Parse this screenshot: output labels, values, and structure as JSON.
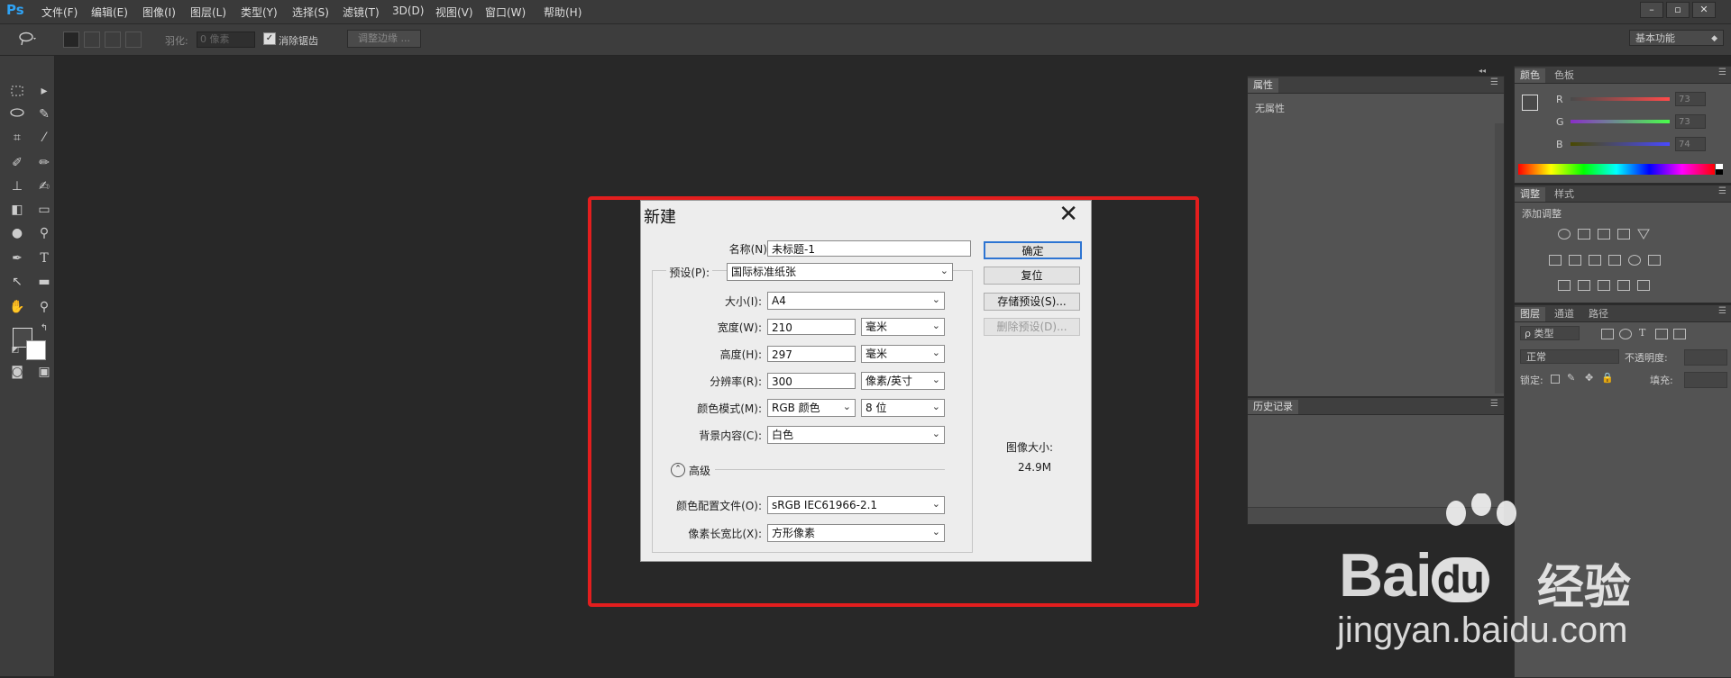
{
  "app": {
    "logo": "Ps",
    "menu": [
      "文件(F)",
      "编辑(E)",
      "图像(I)",
      "图层(L)",
      "类型(Y)",
      "选择(S)",
      "滤镜(T)",
      "3D(D)",
      "视图(V)",
      "窗口(W)",
      "帮助(H)"
    ],
    "window_buttons": [
      "–",
      "▫",
      "✕"
    ]
  },
  "options_bar": {
    "feather_label": "羽化:",
    "feather_value": "0 像素",
    "antialias_label": "消除锯齿",
    "refine_edge_button": "调整边缘 ...",
    "workspace": "基本功能"
  },
  "dialog": {
    "title": "新建",
    "close": "✕",
    "name_label": "名称(N):",
    "name_value": "未标题-1",
    "preset_label": "预设(P):",
    "preset_value": "国际标准纸张",
    "size_label": "大小(I):",
    "size_value": "A4",
    "width_label": "宽度(W):",
    "width_value": "210",
    "width_unit": "毫米",
    "height_label": "高度(H):",
    "height_value": "297",
    "height_unit": "毫米",
    "resolution_label": "分辨率(R):",
    "resolution_value": "300",
    "resolution_unit": "像素/英寸",
    "color_mode_label": "颜色模式(M):",
    "color_mode_value": "RGB 颜色",
    "bit_depth": "8 位",
    "background_label": "背景内容(C):",
    "background_value": "白色",
    "advanced_label": "高级",
    "color_profile_label": "颜色配置文件(O):",
    "color_profile_value": "sRGB IEC61966-2.1",
    "pixel_aspect_label": "像素长宽比(X):",
    "pixel_aspect_value": "方形像素",
    "ok_button": "确定",
    "reset_button": "复位",
    "save_preset_button": "存储预设(S)...",
    "delete_preset_button": "删除预设(D)...",
    "image_size_label": "图像大小:",
    "image_size_value": "24.9M"
  },
  "properties_panel": {
    "tab": "属性",
    "empty_text": "无属性"
  },
  "history_panel": {
    "tab": "历史记录"
  },
  "color_panel": {
    "tabs": [
      "颜色",
      "色板"
    ],
    "channels": [
      {
        "label": "R",
        "value": "73"
      },
      {
        "label": "G",
        "value": "73"
      },
      {
        "label": "B",
        "value": "74"
      }
    ]
  },
  "adjustments_panel": {
    "tabs": [
      "调整",
      "样式"
    ],
    "add_label": "添加调整"
  },
  "layers_panel": {
    "tabs": [
      "图层",
      "通道",
      "路径"
    ],
    "filter_type": "ρ 类型",
    "blend_mode": "正常",
    "opacity_label": "不透明度:",
    "lock_label": "锁定:",
    "fill_label": "填充:"
  },
  "watermark": {
    "brand": "Bai",
    "brand_du": "du",
    "cn": "经验",
    "url": "jingyan.baidu.com"
  },
  "colors": {
    "highlight": "#e31e1e",
    "default_button_border": "#2d74d2",
    "ps_blue": "#2fa3f5"
  }
}
